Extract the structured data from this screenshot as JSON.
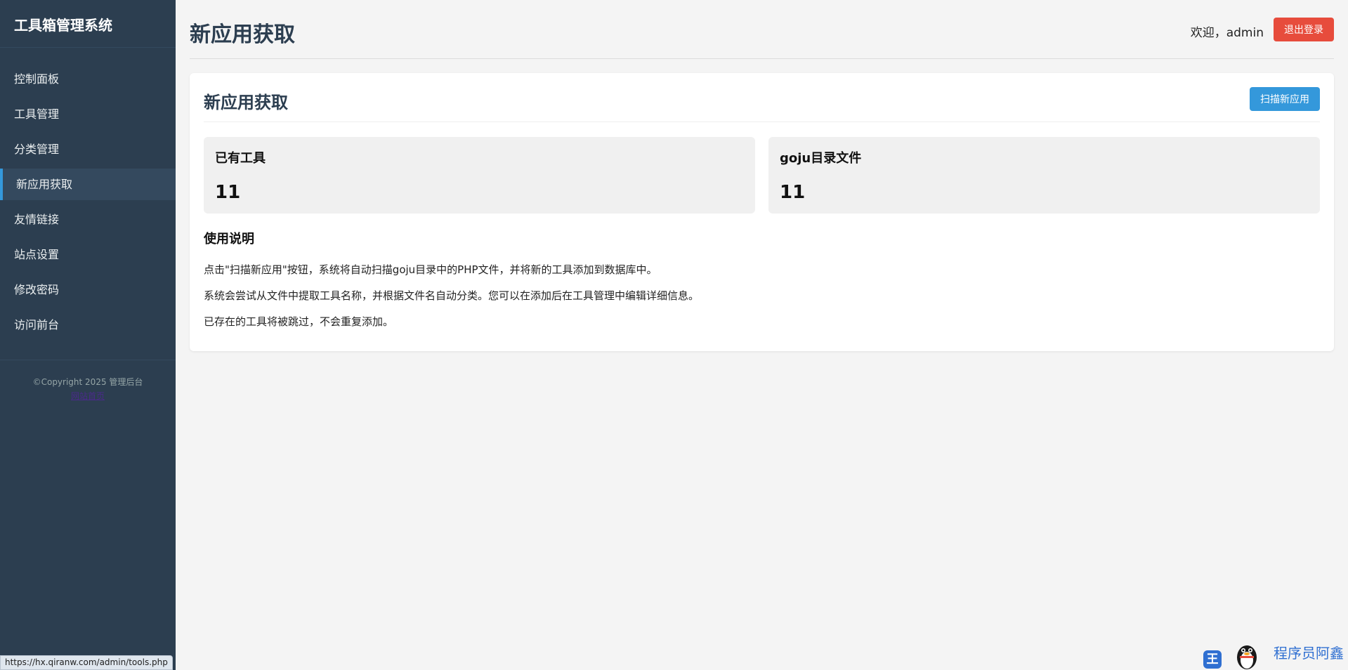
{
  "sidebar": {
    "brand": "工具箱管理系统",
    "items": [
      {
        "label": "控制面板"
      },
      {
        "label": "工具管理"
      },
      {
        "label": "分类管理"
      },
      {
        "label": "新应用获取"
      },
      {
        "label": "友情链接"
      },
      {
        "label": "站点设置"
      },
      {
        "label": "修改密码"
      },
      {
        "label": "访问前台"
      }
    ],
    "footer_copyright": "©Copyright 2025 管理后台",
    "footer_link": "网站首页"
  },
  "header": {
    "page_title": "新应用获取",
    "welcome": "欢迎，admin",
    "logout_label": "退出登录"
  },
  "card": {
    "title": "新应用获取",
    "scan_label": "扫描新应用",
    "stats": [
      {
        "label": "已有工具",
        "value": "11"
      },
      {
        "label": "goju目录文件",
        "value": "11"
      }
    ],
    "usage_title": "使用说明",
    "usage_lines": [
      "点击\"扫描新应用\"按钮，系统将自动扫描goju目录中的PHP文件，并将新的工具添加到数据库中。",
      "系统会尝试从文件中提取工具名称，并根据文件名自动分类。您可以在添加后在工具管理中编辑详细信息。",
      "已存在的工具将被跳过，不会重复添加。"
    ]
  },
  "statusbar": {
    "url": "https://hx.qiranw.com/admin/tools.php"
  },
  "watermark": {
    "badge": "王",
    "text": "程序员阿鑫"
  },
  "colors": {
    "sidebar_bg": "#2c3e50",
    "accent": "#3498db",
    "danger": "#e74c3c",
    "page_bg": "#f4f4f4"
  }
}
